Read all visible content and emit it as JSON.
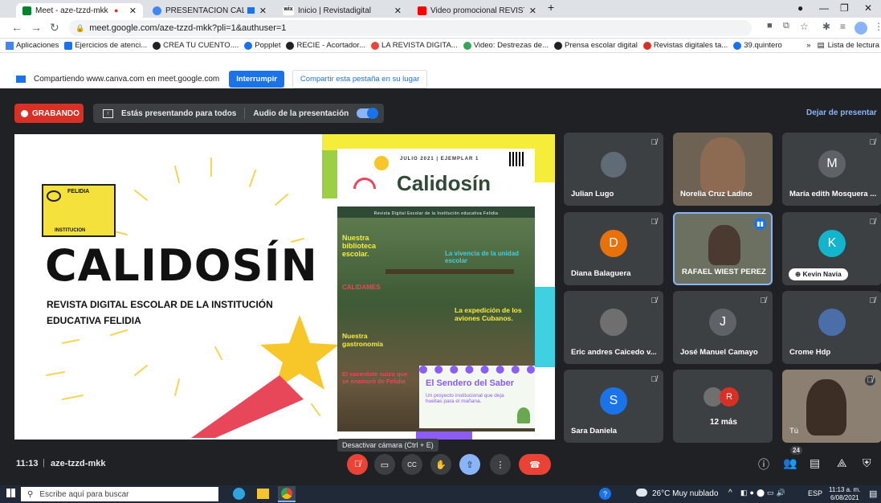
{
  "browser": {
    "tabs": [
      {
        "title": "Meet - aze-tzzd-mkk",
        "icon_color": "#00832d"
      },
      {
        "title": "PRESENTACIÓN CALIDOSÍN",
        "icon_color": "#4285f4"
      },
      {
        "title": "Inicio | Revistadigital",
        "icon_color": "#000000"
      },
      {
        "title": "Video promocional REVISTA DIGI",
        "icon_color": "#ff0000"
      }
    ],
    "new_tab": "+",
    "url": "meet.google.com/aze-tzzd-mkk?pli=1&authuser=1",
    "bookmarks": [
      {
        "label": "Aplicaciones",
        "color": "#4285f4"
      },
      {
        "label": "Ejercicios de atenci...",
        "color": "#1a73e8"
      },
      {
        "label": "CREA TU CUENTO....",
        "color": "#202124"
      },
      {
        "label": "Popplet",
        "color": "#1a73e8"
      },
      {
        "label": "RECIE - Acortador...",
        "color": "#202124"
      },
      {
        "label": "LA REVISTA DIGITA...",
        "color": "#e8453c"
      },
      {
        "label": "Video: Destrezas de...",
        "color": "#34a853"
      },
      {
        "label": "Prensa escolar digital",
        "color": "#202124"
      },
      {
        "label": "Revistas digitales ta...",
        "color": "#d93025"
      },
      {
        "label": "39.quintero",
        "color": "#1a73e8"
      }
    ],
    "reading_list": "Lista de lectura"
  },
  "share_bar": {
    "text": "Compartiendo www.canva.com en meet.google.com",
    "stop_label": "Interrumpir",
    "share_tab_label": "Compartir esta pestaña en su lugar"
  },
  "meet_top": {
    "recording_label": "GRABANDO",
    "presenting_label": "Estás presentando para todos",
    "audio_label": "Audio de la presentación",
    "stop_presenting_label": "Dejar de presentar"
  },
  "slide": {
    "logo_text": "FELIDIA",
    "logo_sub": "INSTITUCION",
    "title": "CALIDOSÍN",
    "subtitle_line1": "REVISTA DIGITAL ESCOLAR DE LA INSTITUCIÓN",
    "subtitle_line2": "EDUCATIVA FELIDIA",
    "magazine": {
      "header": "JULIO 2021 | EJEMPLAR 1",
      "title": "Calidosín",
      "tagline": "Revista Digital Escolar de la Institución educativa Felidia",
      "items_left": [
        "Nuestra biblioteca escolar.",
        "CALIDAMES",
        "Nuestra gastronomía",
        "El sacerdote suizo que se enamoró de Felidia"
      ],
      "items_right": [
        "La vivencia de la unidad escolar",
        "La expedición de los aviones Cubanos."
      ],
      "box_title": "El Sendero del Saber",
      "box_text": "Un proyecto institucional que deja huellas para el mañana."
    }
  },
  "participants": [
    {
      "name": "Julian Lugo",
      "kind": "photo",
      "color": "#5f6b75"
    },
    {
      "name": "Norelia Cruz Ladino",
      "kind": "video",
      "color": "#7a6a5a"
    },
    {
      "name": "María edith Mosquera ...",
      "kind": "letter",
      "letter": "M",
      "color": "#5f6368"
    },
    {
      "name": "Diana Balaguera",
      "kind": "letter",
      "letter": "D",
      "color": "#e8710a"
    },
    {
      "name": "RAFAEL WIEST PEREZ",
      "kind": "video",
      "color": "#6b7060"
    },
    {
      "name": "Kevin Navia",
      "kind": "letter",
      "letter": "K",
      "color": "#12b5cb"
    },
    {
      "name": "Eric andres Caicedo v...",
      "kind": "photo",
      "color": "#6f6f6f"
    },
    {
      "name": "José Manuel Camayo",
      "kind": "letter",
      "letter": "J",
      "color": "#5f6368"
    },
    {
      "name": "Crome Hdp",
      "kind": "photo",
      "color": "#4c6ea8"
    },
    {
      "name": "Sara Daniela",
      "kind": "letter",
      "letter": "S",
      "color": "#1a73e8"
    },
    {
      "name": "12 más",
      "kind": "more",
      "letter": "R",
      "color": "#d93025"
    },
    {
      "name": "Tú",
      "kind": "video",
      "color": "#8a7f70"
    }
  ],
  "meet_bottom": {
    "time": "11:13",
    "meeting_code": "aze-tzzd-mkk",
    "tooltip": "Desactivar cámara (Ctrl + E)",
    "people_count": "24"
  },
  "taskbar": {
    "search_placeholder": "Escribe aquí para buscar",
    "weather": "26°C  Muy nublado",
    "lang": "ESP",
    "clock_time": "11:13 a. m.",
    "clock_date": "6/08/2021"
  }
}
